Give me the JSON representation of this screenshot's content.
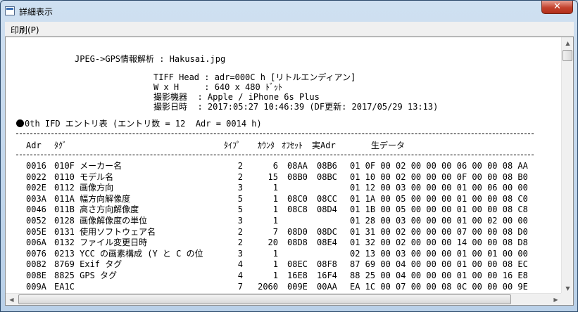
{
  "window": {
    "title": "詳細表示",
    "close_glyph": "✕"
  },
  "menu": {
    "print_label": "印刷(P)"
  },
  "report": {
    "heading": "JPEG->GPS情報解析 : Hakusai.jpg",
    "info": [
      "TIFF Head : adr=000C h [リトルエンディアン]",
      "W x H     : 640 x 480 ﾄﾞｯﾄ",
      "撮影機器  : Apple / iPhone 6s Plus",
      "撮影日時  : 2017:05:27 10:46:39 (DF更新: 2017/05/29 13:13)"
    ],
    "ifd_title": "0th IFD エントリ表 (エントリ数 = 12  Adr = 0014 h)",
    "columns": {
      "adr": "Adr",
      "tag": "ﾀｸﾞ",
      "type": "ﾀｲﾌﾟ",
      "count": "ｶｳﾝﾀ",
      "offset": "ｵﾌｾｯﾄ",
      "real_adr": "実Adr",
      "raw": "生データ"
    },
    "rows": [
      {
        "adr": "0016",
        "tag": "010F メーカー名",
        "type": "2",
        "count": "6",
        "offset": "08AA",
        "real_adr": "08B6",
        "raw": "01 0F 00 02 00 00 00 06 00 00 08 AA"
      },
      {
        "adr": "0022",
        "tag": "0110 モデル名",
        "type": "2",
        "count": "15",
        "offset": "08B0",
        "real_adr": "08BC",
        "raw": "01 10 00 02 00 00 00 0F 00 00 08 B0"
      },
      {
        "adr": "002E",
        "tag": "0112 画像方向",
        "type": "3",
        "count": "1",
        "offset": "",
        "real_adr": "",
        "raw": "01 12 00 03 00 00 00 01 00 06 00 00"
      },
      {
        "adr": "003A",
        "tag": "011A 幅方向解像度",
        "type": "5",
        "count": "1",
        "offset": "08C0",
        "real_adr": "08CC",
        "raw": "01 1A 00 05 00 00 00 01 00 00 08 C0"
      },
      {
        "adr": "0046",
        "tag": "011B 高さ方向解像度",
        "type": "5",
        "count": "1",
        "offset": "08C8",
        "real_adr": "08D4",
        "raw": "01 1B 00 05 00 00 00 01 00 00 08 C8"
      },
      {
        "adr": "0052",
        "tag": "0128 画像解像度の単位",
        "type": "3",
        "count": "1",
        "offset": "",
        "real_adr": "",
        "raw": "01 28 00 03 00 00 00 01 00 02 00 00"
      },
      {
        "adr": "005E",
        "tag": "0131 使用ソフトウェア名",
        "type": "2",
        "count": "7",
        "offset": "08D0",
        "real_adr": "08DC",
        "raw": "01 31 00 02 00 00 00 07 00 00 08 D0"
      },
      {
        "adr": "006A",
        "tag": "0132 ファイル変更日時",
        "type": "2",
        "count": "20",
        "offset": "08D8",
        "real_adr": "08E4",
        "raw": "01 32 00 02 00 00 00 14 00 00 08 D8"
      },
      {
        "adr": "0076",
        "tag": "0213 YCC の画素構成 (Y と C の位",
        "type": "3",
        "count": "1",
        "offset": "",
        "real_adr": "",
        "raw": "02 13 00 03 00 00 00 01 00 01 00 00"
      },
      {
        "adr": "0082",
        "tag": "8769 Exif タグ",
        "type": "4",
        "count": "1",
        "offset": "08EC",
        "real_adr": "08F8",
        "raw": "87 69 00 04 00 00 00 01 00 00 08 EC"
      },
      {
        "adr": "008E",
        "tag": "8825 GPS タグ",
        "type": "4",
        "count": "1",
        "offset": "16E8",
        "real_adr": "16F4",
        "raw": "88 25 00 04 00 00 00 01 00 00 16 E8"
      },
      {
        "adr": "009A",
        "tag": "EA1C",
        "type": "7",
        "count": "2060",
        "offset": "009E",
        "real_adr": "00AA",
        "raw": "EA 1C 00 07 00 00 08 0C 00 00 00 9E"
      }
    ]
  },
  "scrollbars": {
    "up": "▲",
    "down": "▼",
    "left": "◀",
    "right": "▶"
  }
}
